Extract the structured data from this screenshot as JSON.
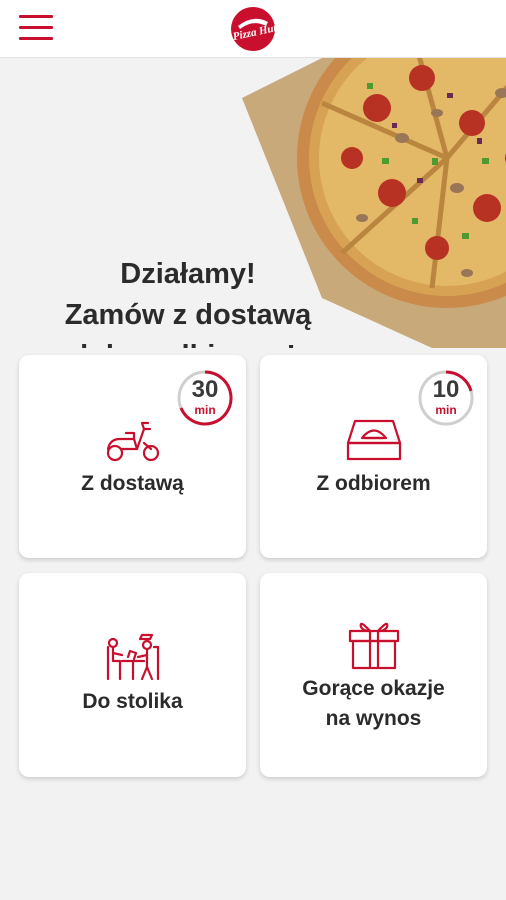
{
  "header": {
    "logo_text": "Pizza Hut"
  },
  "hero": {
    "headline_lines": [
      "Działamy!",
      "Zamów z dostawą",
      "lub z odbiorem!"
    ]
  },
  "options": [
    {
      "label": "Z dostawą",
      "badge_value": "30",
      "badge_unit": "min"
    },
    {
      "label": "Z odbiorem",
      "badge_value": "10",
      "badge_unit": "min"
    },
    {
      "label": "Do stolika"
    },
    {
      "label_lines": [
        "Gorące okazje",
        "na wynos"
      ]
    }
  ],
  "colors": {
    "brand": "#c8102e",
    "background": "#f2f2f2",
    "text": "#2b2b2b"
  },
  "icons": [
    "menu-icon",
    "pizza-hut-logo",
    "scooter-icon",
    "pizza-box-icon",
    "table-service-icon",
    "gift-icon"
  ]
}
